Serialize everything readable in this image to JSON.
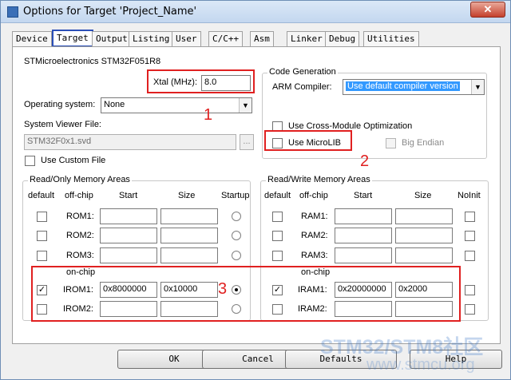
{
  "window": {
    "title": "Options for Target 'Project_Name'",
    "close": "✕"
  },
  "tabs": [
    "Device",
    "Target",
    "Output",
    "Listing",
    "User",
    "C/C++",
    "Asm",
    "Linker",
    "Debug",
    "Utilities"
  ],
  "device": "STMicroelectronics STM32F051R8",
  "xtal": {
    "label": "Xtal (MHz):",
    "value": "8.0"
  },
  "os": {
    "label": "Operating system:",
    "value": "None"
  },
  "svf": {
    "label": "System Viewer File:",
    "value": "STM32F0x1.svd",
    "browse": "..."
  },
  "custom_file": "Use Custom File",
  "codegen": {
    "title": "Code Generation",
    "compiler_label": "ARM Compiler:",
    "compiler_value": "Use default compiler version",
    "cross_module": "Use Cross-Module Optimization",
    "microlib": "Use MicroLIB",
    "big_endian": "Big Endian"
  },
  "rom": {
    "title": "Read/Only Memory Areas",
    "headers": [
      "default",
      "off-chip",
      "Start",
      "Size",
      "Startup"
    ],
    "offchip": [
      "ROM1:",
      "ROM2:",
      "ROM3:"
    ],
    "onchip_label": "on-chip",
    "onchip": [
      {
        "name": "IROM1:",
        "start": "0x8000000",
        "size": "0x10000",
        "checked": true,
        "startup": true
      },
      {
        "name": "IROM2:",
        "start": "",
        "size": "",
        "checked": false,
        "startup": false
      }
    ]
  },
  "ram": {
    "title": "Read/Write Memory Areas",
    "headers": [
      "default",
      "off-chip",
      "Start",
      "Size",
      "NoInit"
    ],
    "offchip": [
      "RAM1:",
      "RAM2:",
      "RAM3:"
    ],
    "onchip_label": "on-chip",
    "onchip": [
      {
        "name": "IRAM1:",
        "start": "0x20000000",
        "size": "0x2000",
        "checked": true
      },
      {
        "name": "IRAM2:",
        "start": "",
        "size": "",
        "checked": false
      }
    ]
  },
  "buttons": {
    "ok": "OK",
    "cancel": "Cancel",
    "defaults": "Defaults",
    "help": "Help"
  },
  "annotations": [
    "1",
    "2",
    "3"
  ],
  "watermark": {
    "line1": "STM32/STM8社区",
    "line2": "www.stmcu.org"
  },
  "colors": {
    "annotation": "#e02020",
    "active_tab": "#2b4fb8",
    "selection": "#3399ff"
  }
}
